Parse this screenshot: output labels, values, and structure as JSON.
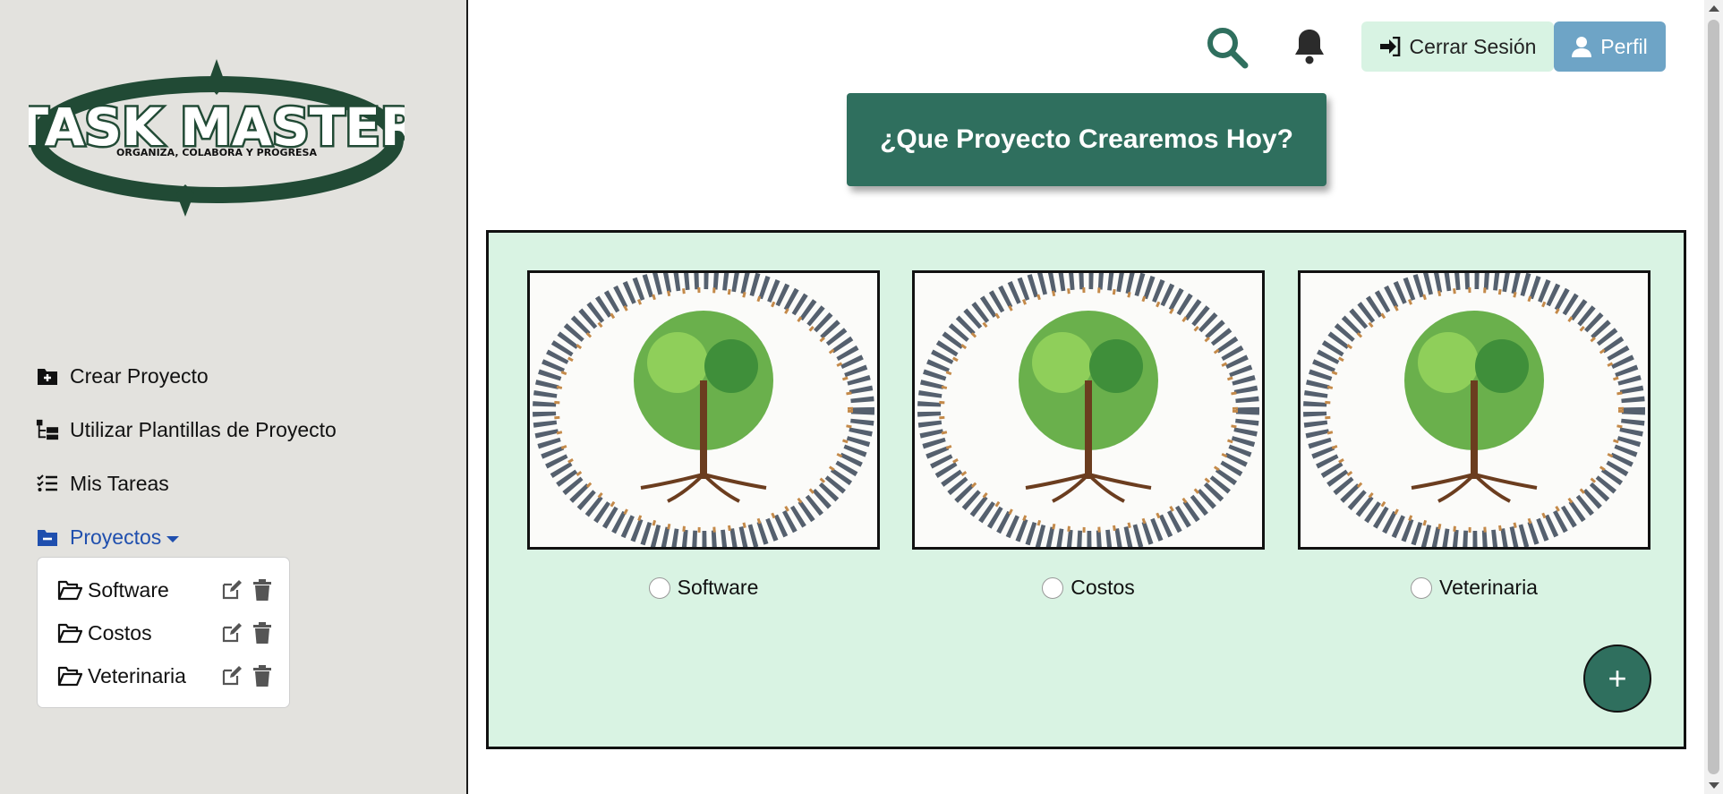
{
  "logo": {
    "title": "TASK MASTER",
    "tagline": "ORGANIZA, COLABORA Y PROGRESA"
  },
  "nav": [
    {
      "label": "Crear Proyecto",
      "icon": "folder-plus-icon"
    },
    {
      "label": "Utilizar Plantillas de Proyecto",
      "icon": "sitemap-icon"
    },
    {
      "label": "Mis Tareas",
      "icon": "list-check-icon"
    },
    {
      "label": "Proyectos",
      "icon": "folder-minus-icon"
    }
  ],
  "projects_menu": [
    {
      "name": "Software"
    },
    {
      "name": "Costos"
    },
    {
      "name": "Veterinaria"
    }
  ],
  "header": {
    "logout_label": "Cerrar Sesión",
    "profile_label": "Perfil"
  },
  "hero": {
    "text": "¿Que Proyecto Crearemos Hoy?"
  },
  "cards": [
    {
      "label": "Software"
    },
    {
      "label": "Costos"
    },
    {
      "label": "Veterinaria"
    }
  ],
  "fab": {
    "label": "+"
  },
  "colors": {
    "accent": "#2f6f5e",
    "sidebar_bg": "#e3e2de",
    "panel_bg": "#d9f3e3",
    "active_link": "#1f4fae",
    "profile_btn": "#6ea4c6",
    "logout_btn": "#d8f3e3"
  }
}
